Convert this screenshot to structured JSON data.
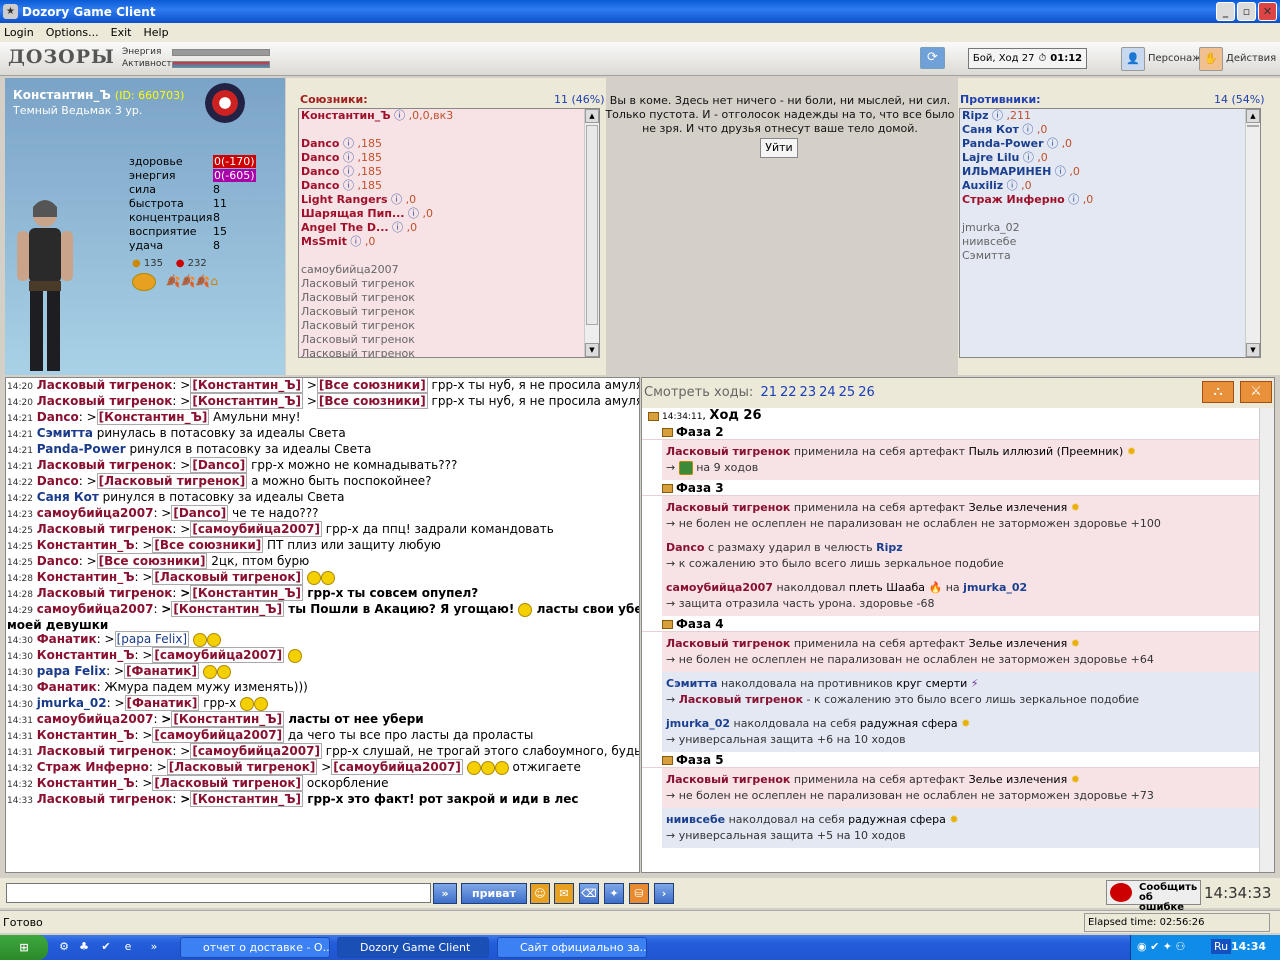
{
  "window": {
    "title": "Dozory Game Client"
  },
  "menu": [
    "Login",
    "Options...",
    "Exit",
    "Help"
  ],
  "toolbar": {
    "logo": "ДОЗОРЫ",
    "energy_label": "Энергия",
    "activity_label": "Активность",
    "turn_text": "Бой, Ход 27",
    "timer": "01:12",
    "persona_label": "Персонаж",
    "actions_label": "Действия"
  },
  "character": {
    "name": "Константин_Ъ",
    "id": "(ID: 660703)",
    "class": "Темный Ведьмак 3 ур.",
    "stats": [
      {
        "label": "здоровье",
        "value": "0(-170)",
        "kind": "hp"
      },
      {
        "label": "энергия",
        "value": "0(-605)",
        "kind": "en"
      },
      {
        "label": "сила",
        "value": "8"
      },
      {
        "label": "быстрота",
        "value": "11"
      },
      {
        "label": "концентрация",
        "value": "8"
      },
      {
        "label": "восприятие",
        "value": "15"
      },
      {
        "label": "удача",
        "value": "8"
      }
    ],
    "money1": "135",
    "money2": "232"
  },
  "allies": {
    "title": "Союзники:",
    "count": "11 (46%)",
    "players": [
      {
        "name": "Константин_Ъ",
        "suffix": ",0,0,вк3",
        "cls": "red"
      },
      {
        "name": "",
        "suffix": "",
        "cls": "red"
      },
      {
        "name": "Danco",
        "suffix": ",185",
        "cls": "red"
      },
      {
        "name": "Danco",
        "suffix": ",185",
        "cls": "red"
      },
      {
        "name": "Danco",
        "suffix": ",185",
        "cls": "red"
      },
      {
        "name": "Danco",
        "suffix": ",185",
        "cls": "red"
      },
      {
        "name": "Light Rangers",
        "suffix": ",0",
        "cls": "red"
      },
      {
        "name": "Шарящая Пип...",
        "suffix": ",0",
        "cls": "red"
      },
      {
        "name": "Angel The D...",
        "suffix": ",0",
        "cls": "red"
      },
      {
        "name": "MsSmit",
        "suffix": ",0",
        "cls": "red"
      }
    ],
    "dead": [
      "самоубийца2007",
      "Ласковый тигренок",
      "Ласковый тигренок",
      "Ласковый тигренок",
      "Ласковый тигренок",
      "Ласковый тигренок",
      "Ласковый тигренок"
    ]
  },
  "coma": {
    "text": "Вы в коме. Здесь нет ничего - ни боли, ни мыслей, ни сил. Только пустота. И - отголосок надежды на то, что все было не зря. И что друзья отнесут ваше тело домой.",
    "leave_button": "Уйти"
  },
  "enemies": {
    "title": "Противники:",
    "count": "14 (54%)",
    "players": [
      {
        "name": "Ripz",
        "suffix": ",211"
      },
      {
        "name": "Саня Кот",
        "suffix": ",0"
      },
      {
        "name": "Panda-Power",
        "suffix": ",0"
      },
      {
        "name": "Lajre Lilu",
        "suffix": ",0"
      },
      {
        "name": "ИЛЬМАРИНЕН",
        "suffix": ",0"
      },
      {
        "name": "Auxiliz",
        "suffix": ",0"
      },
      {
        "name": "Страж Инферно",
        "suffix": ",0",
        "cls": "red"
      }
    ],
    "dead": [
      "jmurka_02",
      "ниивсебе",
      "Сэмитта"
    ]
  },
  "chat": [
    {
      "t": "14:20",
      "html": "<span class='n'>Ласковый тигренок</span>: &gt;<span class='bracket tg'>[Константин_Ъ]</span> &gt;<span class='bracket tg'>[Все союзники]</span> грр-х ты нуб, я не просила амулять!!!"
    },
    {
      "t": "14:20",
      "html": "<span class='n'>Ласковый тигренок</span>: &gt;<span class='bracket tg'>[Константин_Ъ]</span> &gt;<span class='bracket tg'>[Все союзники]</span> грр-х ты нуб, я не просила амулять!!!"
    },
    {
      "t": "14:21",
      "html": "<span class='n'>Danco</span>: &gt;<span class='bracket tg'>[Константин_Ъ]</span> Амульни мну!"
    },
    {
      "t": "14:21",
      "html": "<span class='b'>Сэмитта</span> ринулась в потасовку за идеалы Света"
    },
    {
      "t": "14:21",
      "html": "<span class='b'>Panda-Power</span> ринулся в потасовку за идеалы Света"
    },
    {
      "t": "14:21",
      "html": "<span class='n'>Ласковый тигренок</span>: &gt;<span class='bracket tg'>[Danco]</span> грр-х можно не комнадывать???"
    },
    {
      "t": "14:22",
      "html": "<span class='n'>Danco</span>: &gt;<span class='bracket tg'>[Ласковый тигренок]</span> а можно быть поспокойнее?"
    },
    {
      "t": "14:22",
      "html": "<span class='b'>Саня Кот</span> ринулся в потасовку за идеалы Света"
    },
    {
      "t": "14:23",
      "html": "<span class='n'>самоубийца2007</span>: &gt;<span class='bracket tg'>[Danco]</span> че те надо???"
    },
    {
      "t": "14:25",
      "html": "<span class='n'>Ласковый тигренок</span>: &gt;<span class='bracket tg'>[самоубийца2007]</span> грр-х да ппц! задрали командовать"
    },
    {
      "t": "14:25",
      "html": "<span class='n'>Константин_Ъ</span>: &gt;<span class='bracket tg'>[Все союзники]</span> ПТ плиз или защиту любую"
    },
    {
      "t": "14:25",
      "html": "<span class='n'>Danco</span>: &gt;<span class='bracket tg'>[Все союзники]</span> 2цк, птом бурю"
    },
    {
      "t": "14:28",
      "html": "<span class='n'>Константин_Ъ</span>: &gt;<span class='bracket tg'>[Ласковый тигренок]</span> <span class='smile'></span><span class='smile'></span>"
    },
    {
      "t": "14:28",
      "html": "<span class='n'>Ласковый тигренок</span>: <span class='bold'>&gt;<span class='bracket tg'>[Константин_Ъ]</span> грр-х ты совсем опупел?</span>"
    },
    {
      "t": "14:29",
      "html": "<span class='n'>самоубийца2007</span>: <span class='bold'>&gt;<span class='bracket tg'>[Константин_Ъ]</span> ты Пошли в Акацию? Я угощаю! <span class='smile'></span> ласты свои убери от</span>"
    },
    {
      "t": "",
      "html": "<span class='bold'>моей девушки</span>"
    },
    {
      "t": "14:30",
      "html": "<span class='n'>Фанатик</span>: &gt;<span class='bracket tgb'>[papa Felix]</span> <span class='smile'></span><span class='smile'></span>"
    },
    {
      "t": "14:30",
      "html": "<span class='n'>Константин_Ъ</span>: &gt;<span class='bracket tg'>[самоубийца2007]</span> <span class='smile'></span>"
    },
    {
      "t": "14:30",
      "html": "<span class='b'>papa Felix</span>: &gt;<span class='bracket tg'>[Фанатик]</span> <span class='smile'></span><span class='smile'></span>"
    },
    {
      "t": "14:30",
      "html": "<span class='n'>Фанатик</span>: Жмура падем мужу изменять)))"
    },
    {
      "t": "14:30",
      "html": "<span class='b'>jmurka_02</span>: &gt;<span class='bracket tg'>[Фанатик]</span> грр-х <span class='smile'></span><span class='smile'></span>"
    },
    {
      "t": "14:31",
      "html": "<span class='n'>самоубийца2007</span>: <span class='bold'>&gt;<span class='bracket tg'>[Константин_Ъ]</span> ласты от нее убери</span>"
    },
    {
      "t": "14:31",
      "html": "<span class='n'>Константин_Ъ</span>: &gt;<span class='bracket tg'>[самоубийца2007]</span> да чего ты все про ласты да проласты"
    },
    {
      "t": "14:31",
      "html": "<span class='n'>Ласковый тигренок</span>: &gt;<span class='bracket tg'>[самоубийца2007]</span> грр-х слушай, не трогай этого слабоумного, будь выше"
    },
    {
      "t": "14:32",
      "html": "<span class='n'>Страж Инферно</span>: &gt;<span class='bracket tg'>[Ласковый тигренок]</span> &gt;<span class='bracket tg'>[самоубийца2007]</span> <span class='smile'></span><span class='smile'></span><span class='smile'></span> отжигаете"
    },
    {
      "t": "14:32",
      "html": "<span class='n'>Константин_Ъ</span>: &gt;<span class='bracket tg'>[Ласковый тигренок]</span> оскорбление"
    },
    {
      "t": "14:33",
      "html": "<span class='n'>Ласковый тигренок</span>: <span class='bold'>&gt;<span class='bracket tg'>[Константин_Ъ]</span> грр-х это факт! рот закрой и иди в лес</span>"
    }
  ],
  "moves": {
    "label": "Смотреть ходы:",
    "items": [
      "21",
      "22",
      "23",
      "24",
      "25",
      "26"
    ]
  },
  "log": {
    "turn_time": "14:34:11",
    "turn_label": "Ход 26",
    "phases": [
      {
        "name": "Фаза 2",
        "blocks": [
          {
            "color": "pink",
            "lines": [
              "<span class='nn'>Ласковый тигренок</span> применила на себя артефакт <span class='it'>Пыль иллюзий (Преемник)</span> <span class='star'>✹</span>",
              "→ <span class='smile' style='background:#3a8a3a;border-radius:2px'></span> на 9 ходов"
            ]
          }
        ]
      },
      {
        "name": "Фаза 3",
        "blocks": [
          {
            "color": "pink",
            "lines": [
              "<span class='nn'>Ласковый тигренок</span> применила на себя артефакт <span class='it'>Зелье излечения</span> <span class='star'>✹</span>",
              "→ не болен не ослеплен не парализован не ослаблен не заторможен здоровье +100"
            ]
          },
          {
            "color": "pink",
            "lines": [
              "<span class='nn'>Danco</span> с размаху ударил в челюсть <span class='nb'>Ripz</span>",
              "→ к сожалению это было всего лишь зеркальное подобие"
            ]
          },
          {
            "color": "pink",
            "lines": [
              "<span class='nn'>самоубийца2007</span> наколдовал <span class='it'>плеть Шааба</span> <span style='color:#e05000'>🔥</span> на <span class='nb'>jmurka_02</span>",
              "→ защита отразила часть урона. здоровье -68"
            ]
          }
        ]
      },
      {
        "name": "Фаза 4",
        "blocks": [
          {
            "color": "pink",
            "lines": [
              "<span class='nn'>Ласковый тигренок</span> применила на себя артефакт <span class='it'>Зелье излечения</span> <span class='star'>✹</span>",
              "→ не болен не ослеплен не парализован не ослаблен не заторможен здоровье +64"
            ]
          },
          {
            "color": "blu",
            "lines": [
              "<span class='nb'>Сэмитта</span> наколдовала на противников <span class='it'>круг смерти</span> <span style='color:#7030a0'>⚡</span>",
              "→ <span class='nn'>Ласковый тигренок</span> - к сожалению это было всего лишь зеркальное подобие"
            ]
          },
          {
            "color": "blu",
            "lines": [
              "<span class='nb'>jmurka_02</span> наколдовала на себя <span class='it'>радужная сфера</span> <span class='star'>✹</span>",
              "→ универсальная защита +6 на 10 ходов"
            ]
          }
        ]
      },
      {
        "name": "Фаза 5",
        "blocks": [
          {
            "color": "pink",
            "lines": [
              "<span class='nn'>Ласковый тигренок</span> применила на себя артефакт <span class='it'>Зелье излечения</span> <span class='star'>✹</span>",
              "→ не болен не ослеплен не парализован не ослаблен не заторможен здоровье +73"
            ]
          },
          {
            "color": "blu",
            "lines": [
              "<span class='nb'>ниивсебе</span> наколдовал на себя <span class='it'>радужная сфера</span> <span class='star'>✹</span>",
              "→ универсальная защита +5 на 10 ходов"
            ]
          }
        ]
      }
    ]
  },
  "input": {
    "private_label": "приват",
    "report_label": "Сообщить об ошибке",
    "clock": "14:34:33"
  },
  "status": {
    "ready": "Готово",
    "elapsed": "Elapsed time: 02:56:26"
  },
  "taskbar": {
    "tasks": [
      "отчет о доставке - О...",
      "Dozory Game Client",
      "Сайт официально за..."
    ],
    "lang": "Ru",
    "time": "14:34"
  }
}
